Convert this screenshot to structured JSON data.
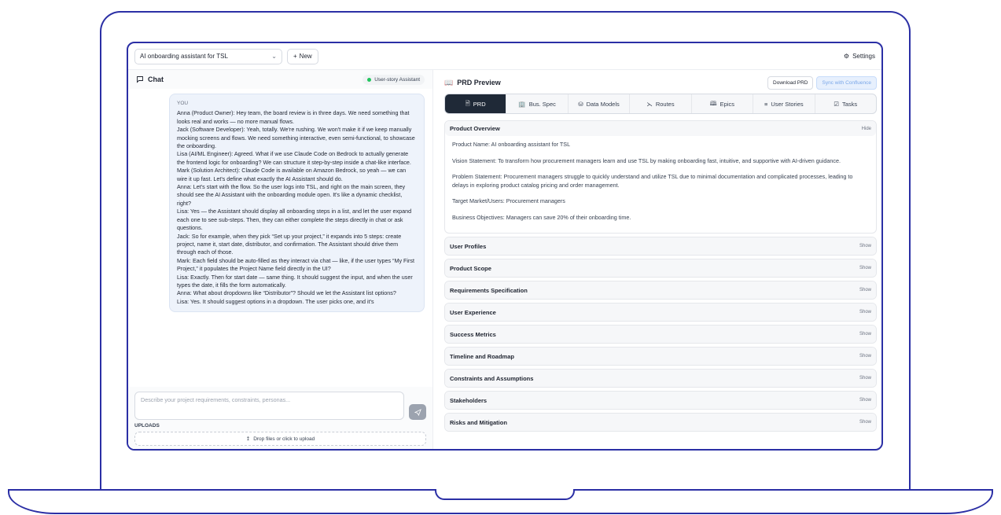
{
  "topbar": {
    "project": "AI onboarding assistant for TSL",
    "new_label": "New",
    "settings_label": "Settings"
  },
  "chat": {
    "title": "Chat",
    "agent": "User-story Assistant",
    "message_sender": "YOU",
    "messages": [
      "Anna (Product Owner): Hey team, the board review is in three days. We need something that looks real and works — no more manual flows.",
      "Jack (Software Developer): Yeah, totally. We're rushing. We won't make it if we keep manually mocking screens and flows. We need something interactive, even semi-functional, to showcase the onboarding.",
      "Lisa (AI/ML Engineer): Agreed. What if we use Claude Code on Bedrock to actually generate the frontend logic for onboarding? We can structure it step-by-step inside a chat-like interface.",
      "Mark (Solution Architect): Claude Code is available on Amazon Bedrock, so yeah — we can wire it up fast. Let's define what exactly the AI Assistant should do.",
      "Anna: Let's start with the flow. So the user logs into TSL, and right on the main screen, they should see the AI Assistant with the onboarding module open. It's like a dynamic checklist, right?",
      "Lisa: Yes — the Assistant should display all onboarding steps in a list, and let the user expand each one to see sub-steps. Then, they can either complete the steps directly in chat or ask questions.",
      "Jack: So for example, when they pick “Set up your project,” it expands into 5 steps: create project, name it, start date, distributor, and confirmation. The Assistant should drive them through each of those.",
      "Mark: Each field should be auto-filled as they interact via chat — like, if the user types “My First Project,” it populates the Project Name field directly in the UI?",
      "Lisa: Exactly. Then for start date — same thing. It should suggest the input, and when the user types the date, it fills the form automatically.",
      "Anna: What about dropdowns like “Distributor”? Should we let the Assistant list options?",
      "Lisa: Yes. It should suggest options in a dropdown. The user picks one, and it's"
    ],
    "input_placeholder": "Describe your project requirements, constraints, personas...",
    "uploads_label": "UPLOADS",
    "dropzone_label": "Drop files or click to upload"
  },
  "prd": {
    "title": "PRD Preview",
    "download_label": "Download PRD",
    "sync_label": "Sync with Confluence",
    "tabs": [
      {
        "label": "PRD",
        "icon": "document-icon"
      },
      {
        "label": "Bus. Spec",
        "icon": "building-icon"
      },
      {
        "label": "Data Models",
        "icon": "database-icon"
      },
      {
        "label": "Routes",
        "icon": "routes-icon"
      },
      {
        "label": "Epics",
        "icon": "book-icon"
      },
      {
        "label": "User Stories",
        "icon": "list-icon"
      },
      {
        "label": "Tasks",
        "icon": "checkbox-icon"
      }
    ],
    "overview": {
      "title": "Product Overview",
      "toggle": "Hide",
      "lines": [
        "Product Name: AI onboarding assistant for TSL",
        "Vision Statement: To transform how procurement managers learn and use TSL by making onboarding fast, intuitive, and supportive with AI-driven guidance.",
        "Problem Statement: Procurement managers struggle to quickly understand and utilize TSL due to minimal documentation and complicated processes, leading to delays in exploring product catalog pricing and order management.",
        "Target Market/Users: Procurement managers",
        "Business Objectives: Managers can save 20% of their onboarding time."
      ]
    },
    "sections": [
      {
        "title": "User Profiles",
        "toggle": "Show"
      },
      {
        "title": "Product Scope",
        "toggle": "Show"
      },
      {
        "title": "Requirements Specification",
        "toggle": "Show"
      },
      {
        "title": "User Experience",
        "toggle": "Show"
      },
      {
        "title": "Success Metrics",
        "toggle": "Show"
      },
      {
        "title": "Timeline and Roadmap",
        "toggle": "Show"
      },
      {
        "title": "Constraints and Assumptions",
        "toggle": "Show"
      },
      {
        "title": "Stakeholders",
        "toggle": "Show"
      },
      {
        "title": "Risks and Mitigation",
        "toggle": "Show"
      }
    ]
  }
}
